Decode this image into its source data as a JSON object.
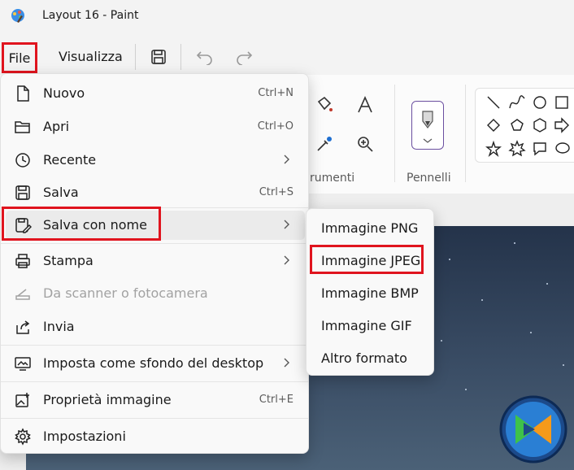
{
  "window": {
    "title": "Layout 16 - Paint"
  },
  "menubar": {
    "file": "File",
    "view": "Visualizza"
  },
  "ribbon": {
    "tools_label": "rumenti",
    "brushes_label": "Pennelli"
  },
  "file_menu": {
    "items": [
      {
        "label": "Nuovo",
        "shortcut": "Ctrl+N",
        "icon": "new-file-icon"
      },
      {
        "label": "Apri",
        "shortcut": "Ctrl+O",
        "icon": "folder-icon"
      },
      {
        "label": "Recente",
        "shortcut": "",
        "icon": "clock-icon"
      },
      {
        "label": "Salva",
        "shortcut": "Ctrl+S",
        "icon": "save-icon"
      },
      {
        "label": "Salva con nome",
        "shortcut": "",
        "icon": "save-as-icon"
      },
      {
        "label": "Stampa",
        "shortcut": "",
        "icon": "printer-icon"
      },
      {
        "label": "Da scanner o fotocamera",
        "shortcut": "",
        "icon": "scanner-icon"
      },
      {
        "label": "Invia",
        "shortcut": "",
        "icon": "share-icon"
      },
      {
        "label": "Imposta come sfondo del desktop",
        "shortcut": "",
        "icon": "desktop-icon"
      },
      {
        "label": "Proprietà immagine",
        "shortcut": "Ctrl+E",
        "icon": "image-properties-icon"
      },
      {
        "label": "Impostazioni",
        "shortcut": "",
        "icon": "gear-icon"
      }
    ]
  },
  "save_as_submenu": {
    "items": [
      {
        "label": "Immagine PNG"
      },
      {
        "label": "Immagine JPEG"
      },
      {
        "label": "Immagine BMP"
      },
      {
        "label": "Immagine GIF"
      },
      {
        "label": "Altro formato"
      }
    ]
  },
  "colors": {
    "highlight": "#e0141e",
    "accent": "#6b4fa0"
  }
}
